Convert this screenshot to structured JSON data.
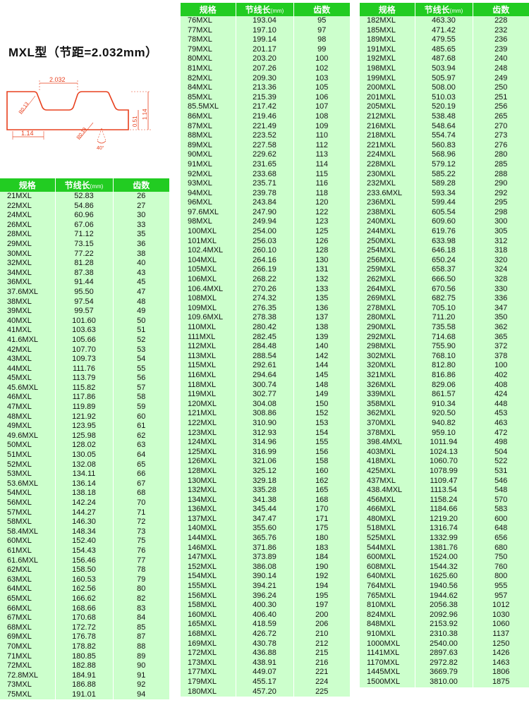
{
  "title": "MXL型（节距=2.032mm）",
  "diagram": {
    "pitch": "2.032",
    "r_top": "R0.13",
    "r_bottom": "R0.13",
    "width": "1.14",
    "depth": "0.51",
    "height": "1.14",
    "angle": "40°"
  },
  "headers": {
    "model": "规格",
    "length": "节线长",
    "unit": "(mm)",
    "teeth": "齿数"
  },
  "tables": [
    {
      "rows": [
        [
          "21MXL",
          "52.83",
          "26"
        ],
        [
          "22MXL",
          "54.86",
          "27"
        ],
        [
          "24MXL",
          "60.96",
          "30"
        ],
        [
          "26MXL",
          "67.06",
          "33"
        ],
        [
          "28MXL",
          "71.12",
          "35"
        ],
        [
          "29MXL",
          "73.15",
          "36"
        ],
        [
          "30MXL",
          "77.22",
          "38"
        ],
        [
          "32MXL",
          "81.28",
          "40"
        ],
        [
          "34MXL",
          "87.38",
          "43"
        ],
        [
          "36MXL",
          "91.44",
          "45"
        ],
        [
          "37.6MXL",
          "95.50",
          "47"
        ],
        [
          "38MXL",
          "97.54",
          "48"
        ],
        [
          "39MXL",
          "99.57",
          "49"
        ],
        [
          "40MXL",
          "101.60",
          "50"
        ],
        [
          "41MXL",
          "103.63",
          "51"
        ],
        [
          "41.6MXL",
          "105.66",
          "52"
        ],
        [
          "42MXL",
          "107.70",
          "53"
        ],
        [
          "43MXL",
          "109.73",
          "54"
        ],
        [
          "44MXL",
          "111.76",
          "55"
        ],
        [
          "45MXL",
          "113.79",
          "56"
        ],
        [
          "45.6MXL",
          "115.82",
          "57"
        ],
        [
          "46MXL",
          "117.86",
          "58"
        ],
        [
          "47MXL",
          "119.89",
          "59"
        ],
        [
          "48MXL",
          "121.92",
          "60"
        ],
        [
          "49MXL",
          "123.95",
          "61"
        ],
        [
          "49.6MXL",
          "125.98",
          "62"
        ],
        [
          "50MXL",
          "128.02",
          "63"
        ],
        [
          "51MXL",
          "130.05",
          "64"
        ],
        [
          "52MXL",
          "132.08",
          "65"
        ],
        [
          "53MXL",
          "134.11",
          "66"
        ],
        [
          "53.6MXL",
          "136.14",
          "67"
        ],
        [
          "54MXL",
          "138.18",
          "68"
        ],
        [
          "56MXL",
          "142.24",
          "70"
        ],
        [
          "57MXL",
          "144.27",
          "71"
        ],
        [
          "58MXL",
          "146.30",
          "72"
        ],
        [
          "58.4MXL",
          "148.34",
          "73"
        ],
        [
          "60MXL",
          "152.40",
          "75"
        ],
        [
          "61MXL",
          "154.43",
          "76"
        ],
        [
          "61.6MXL",
          "156.46",
          "77"
        ],
        [
          "62MXL",
          "158.50",
          "78"
        ],
        [
          "63MXL",
          "160.53",
          "79"
        ],
        [
          "64MXL",
          "162.56",
          "80"
        ],
        [
          "65MXL",
          "166.62",
          "82"
        ],
        [
          "66MXL",
          "168.66",
          "83"
        ],
        [
          "67MXL",
          "170.68",
          "84"
        ],
        [
          "68MXL",
          "172.72",
          "85"
        ],
        [
          "69MXL",
          "176.78",
          "87"
        ],
        [
          "70MXL",
          "178.82",
          "88"
        ],
        [
          "71MXL",
          "180.85",
          "89"
        ],
        [
          "72MXL",
          "182.88",
          "90"
        ],
        [
          "72.8MXL",
          "184.91",
          "91"
        ],
        [
          "73MXL",
          "186.88",
          "92"
        ],
        [
          "75MXL",
          "191.01",
          "94"
        ]
      ]
    },
    {
      "rows": [
        [
          "76MXL",
          "193.04",
          "95"
        ],
        [
          "77MXL",
          "197.10",
          "97"
        ],
        [
          "78MXL",
          "199.14",
          "98"
        ],
        [
          "79MXL",
          "201.17",
          "99"
        ],
        [
          "80MXL",
          "203.20",
          "100"
        ],
        [
          "81MXL",
          "207.26",
          "102"
        ],
        [
          "82MXL",
          "209.30",
          "103"
        ],
        [
          "84MXL",
          "213.36",
          "105"
        ],
        [
          "85MXL",
          "215.39",
          "106"
        ],
        [
          "85.5MXL",
          "217.42",
          "107"
        ],
        [
          "86MXL",
          "219.46",
          "108"
        ],
        [
          "87MXL",
          "221.49",
          "109"
        ],
        [
          "88MXL",
          "223.52",
          "110"
        ],
        [
          "89MXL",
          "227.58",
          "112"
        ],
        [
          "90MXL",
          "229.62",
          "113"
        ],
        [
          "91MXL",
          "231.65",
          "114"
        ],
        [
          "92MXL",
          "233.68",
          "115"
        ],
        [
          "93MXL",
          "235.71",
          "116"
        ],
        [
          "94MXL",
          "239.78",
          "118"
        ],
        [
          "96MXL",
          "243.84",
          "120"
        ],
        [
          "97.6MXL",
          "247.90",
          "122"
        ],
        [
          "98MXL",
          "249.94",
          "123"
        ],
        [
          "100MXL",
          "254.00",
          "125"
        ],
        [
          "101MXL",
          "256.03",
          "126"
        ],
        [
          "102.4MXL",
          "260.10",
          "128"
        ],
        [
          "104MXL",
          "264.16",
          "130"
        ],
        [
          "105MXL",
          "266.19",
          "131"
        ],
        [
          "106MXL",
          "268.22",
          "132"
        ],
        [
          "106.4MXL",
          "270.26",
          "133"
        ],
        [
          "108MXL",
          "274.32",
          "135"
        ],
        [
          "109MXL",
          "276.35",
          "136"
        ],
        [
          "109.6MXL",
          "278.38",
          "137"
        ],
        [
          "110MXL",
          "280.42",
          "138"
        ],
        [
          "111MXL",
          "282.45",
          "139"
        ],
        [
          "112MXL",
          "284.48",
          "140"
        ],
        [
          "113MXL",
          "288.54",
          "142"
        ],
        [
          "115MXL",
          "292.61",
          "144"
        ],
        [
          "116MXL",
          "294.64",
          "145"
        ],
        [
          "118MXL",
          "300.74",
          "148"
        ],
        [
          "119MXL",
          "302.77",
          "149"
        ],
        [
          "120MXL",
          "304.08",
          "150"
        ],
        [
          "121MXL",
          "308.86",
          "152"
        ],
        [
          "122MXL",
          "310.90",
          "153"
        ],
        [
          "123MXL",
          "312.93",
          "154"
        ],
        [
          "124MXL",
          "314.96",
          "155"
        ],
        [
          "125MXL",
          "316.99",
          "156"
        ],
        [
          "126MXL",
          "321.06",
          "158"
        ],
        [
          "128MXL",
          "325.12",
          "160"
        ],
        [
          "130MXL",
          "329.18",
          "162"
        ],
        [
          "132MXL",
          "335.28",
          "165"
        ],
        [
          "134MXL",
          "341.38",
          "168"
        ],
        [
          "136MXL",
          "345.44",
          "170"
        ],
        [
          "137MXL",
          "347.47",
          "171"
        ],
        [
          "140MXL",
          "355.60",
          "175"
        ],
        [
          "144MXL",
          "365.76",
          "180"
        ],
        [
          "146MXL",
          "371.86",
          "183"
        ],
        [
          "147MXL",
          "373.89",
          "184"
        ],
        [
          "152MXL",
          "386.08",
          "190"
        ],
        [
          "154MXL",
          "390.14",
          "192"
        ],
        [
          "155MXL",
          "394.21",
          "194"
        ],
        [
          "156MXL",
          "396.24",
          "195"
        ],
        [
          "158MXL",
          "400.30",
          "197"
        ],
        [
          "160MXL",
          "406.40",
          "200"
        ],
        [
          "165MXL",
          "418.59",
          "206"
        ],
        [
          "168MXL",
          "426.72",
          "210"
        ],
        [
          "169MXL",
          "430.78",
          "212"
        ],
        [
          "172MXL",
          "436.88",
          "215"
        ],
        [
          "173MXL",
          "438.91",
          "216"
        ],
        [
          "177MXL",
          "449.07",
          "221"
        ],
        [
          "179MXL",
          "455.17",
          "224"
        ],
        [
          "180MXL",
          "457.20",
          "225"
        ]
      ]
    },
    {
      "rows": [
        [
          "182MXL",
          "463.30",
          "228"
        ],
        [
          "185MXL",
          "471.42",
          "232"
        ],
        [
          "189MXL",
          "479.55",
          "236"
        ],
        [
          "191MXL",
          "485.65",
          "239"
        ],
        [
          "192MXL",
          "487.68",
          "240"
        ],
        [
          "198MXL",
          "503.94",
          "248"
        ],
        [
          "199MXL",
          "505.97",
          "249"
        ],
        [
          "200MXL",
          "508.00",
          "250"
        ],
        [
          "201MXL",
          "510.03",
          "251"
        ],
        [
          "205MXL",
          "520.19",
          "256"
        ],
        [
          "212MXL",
          "538.48",
          "265"
        ],
        [
          "216MXL",
          "548.64",
          "270"
        ],
        [
          "218MXL",
          "554.74",
          "273"
        ],
        [
          "221MXL",
          "560.83",
          "276"
        ],
        [
          "224MXL",
          "568.96",
          "280"
        ],
        [
          "228MXL",
          "579.12",
          "285"
        ],
        [
          "230MXL",
          "585.22",
          "288"
        ],
        [
          "232MXL",
          "589.28",
          "290"
        ],
        [
          "233.6MXL",
          "593.34",
          "292"
        ],
        [
          "236MXL",
          "599.44",
          "295"
        ],
        [
          "238MXL",
          "605.54",
          "298"
        ],
        [
          "240MXL",
          "609.60",
          "300"
        ],
        [
          "244MXL",
          "619.76",
          "305"
        ],
        [
          "250MXL",
          "633.98",
          "312"
        ],
        [
          "254MXL",
          "646.18",
          "318"
        ],
        [
          "256MXL",
          "650.24",
          "320"
        ],
        [
          "259MXL",
          "658.37",
          "324"
        ],
        [
          "262MXL",
          "666.50",
          "328"
        ],
        [
          "264MXL",
          "670.56",
          "330"
        ],
        [
          "269MXL",
          "682.75",
          "336"
        ],
        [
          "278MXL",
          "705.10",
          "347"
        ],
        [
          "280MXL",
          "711.20",
          "350"
        ],
        [
          "290MXL",
          "735.58",
          "362"
        ],
        [
          "292MXL",
          "714.68",
          "365"
        ],
        [
          "298MXL",
          "755.90",
          "372"
        ],
        [
          "302MXL",
          "768.10",
          "378"
        ],
        [
          "320MXL",
          "812.80",
          "100"
        ],
        [
          "321MXL",
          "816.86",
          "402"
        ],
        [
          "326MXL",
          "829.06",
          "408"
        ],
        [
          "339MXL",
          "861.57",
          "424"
        ],
        [
          "358MXL",
          "910.34",
          "448"
        ],
        [
          "362MXL",
          "920.50",
          "453"
        ],
        [
          "370MXL",
          "940.82",
          "463"
        ],
        [
          "378MXL",
          "959.10",
          "472"
        ],
        [
          "398.4MXL",
          "1011.94",
          "498"
        ],
        [
          "403MXL",
          "1024.13",
          "504"
        ],
        [
          "418MXL",
          "1060.70",
          "522"
        ],
        [
          "425MXL",
          "1078.99",
          "531"
        ],
        [
          "437MXL",
          "1109.47",
          "546"
        ],
        [
          "438.4MXL",
          "1113.54",
          "548"
        ],
        [
          "456MXL",
          "1158.24",
          "570"
        ],
        [
          "466MXL",
          "1184.66",
          "583"
        ],
        [
          "480MXL",
          "1219.20",
          "600"
        ],
        [
          "518MXL",
          "1316.74",
          "648"
        ],
        [
          "525MXL",
          "1332.99",
          "656"
        ],
        [
          "544MXL",
          "1381.76",
          "680"
        ],
        [
          "600MXL",
          "1524.00",
          "750"
        ],
        [
          "608MXL",
          "1544.32",
          "760"
        ],
        [
          "640MXL",
          "1625.60",
          "800"
        ],
        [
          "764MXL",
          "1940.56",
          "955"
        ],
        [
          "765MXL",
          "1944.62",
          "957"
        ],
        [
          "810MXL",
          "2056.38",
          "1012"
        ],
        [
          "824MXL",
          "2092.96",
          "1030"
        ],
        [
          "848MXL",
          "2153.92",
          "1060"
        ],
        [
          "910MXL",
          "2310.38",
          "1137"
        ],
        [
          "1000MXL",
          "2540.00",
          "1250"
        ],
        [
          "1141MXL",
          "2897.63",
          "1426"
        ],
        [
          "1170MXL",
          "2972.82",
          "1463"
        ],
        [
          "1445MXL",
          "3669.79",
          "1806"
        ],
        [
          "1500MXL",
          "3810.00",
          "1875"
        ]
      ]
    }
  ]
}
